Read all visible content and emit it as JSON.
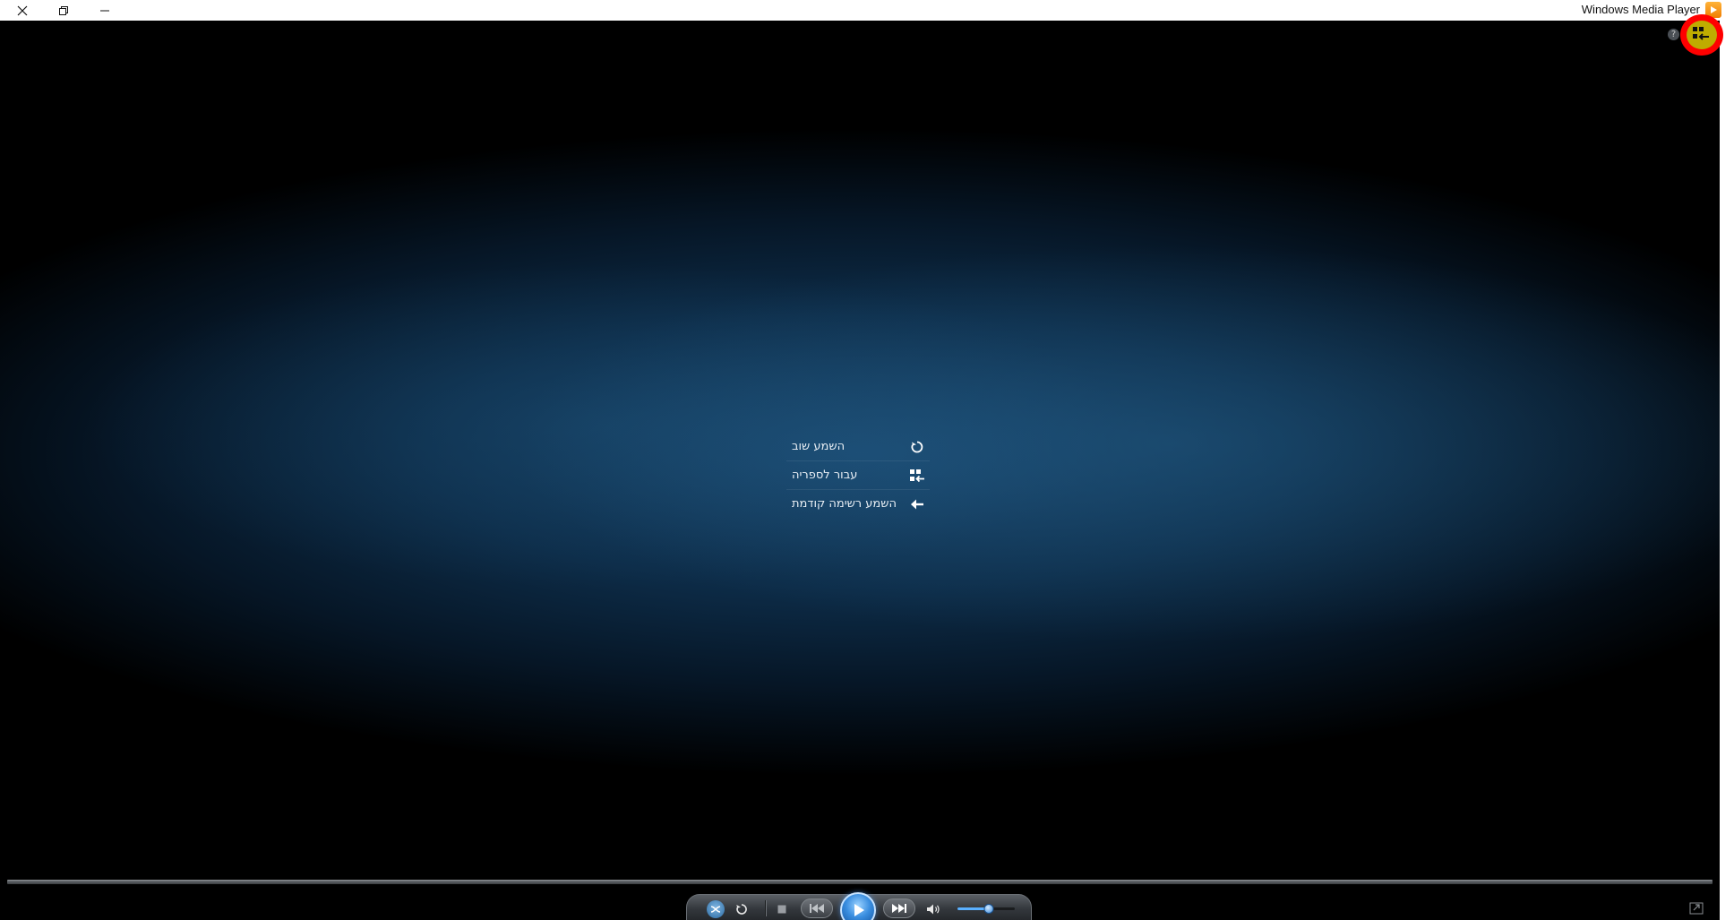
{
  "window": {
    "title": "Windows Media Player",
    "buttons": {
      "close_icon": "close-icon",
      "restore_icon": "restore-icon",
      "minimize_icon": "minimize-icon"
    }
  },
  "top_right": {
    "help_glyph": "?",
    "switch_icon": "switch-to-library-icon",
    "highlight_color": "#ff0000",
    "highlight_fill": "#ffe600"
  },
  "center_menu": {
    "items": [
      {
        "label": "השמע שוב",
        "icon": "replay-icon"
      },
      {
        "label": "עבור לספריה",
        "icon": "library-icon"
      },
      {
        "label": "השמע רשימה קודמת",
        "icon": "back-arrow-icon"
      }
    ]
  },
  "controls": {
    "shuffle_icon": "shuffle-icon",
    "repeat_icon": "repeat-icon",
    "stop_icon": "stop-icon",
    "previous_icon": "previous-icon",
    "play_icon": "play-icon",
    "next_icon": "next-icon",
    "mute_icon": "speaker-icon",
    "volume_percent": 55,
    "accent_color": "#3a8ee0"
  },
  "seek": {
    "progress_percent": 0
  }
}
